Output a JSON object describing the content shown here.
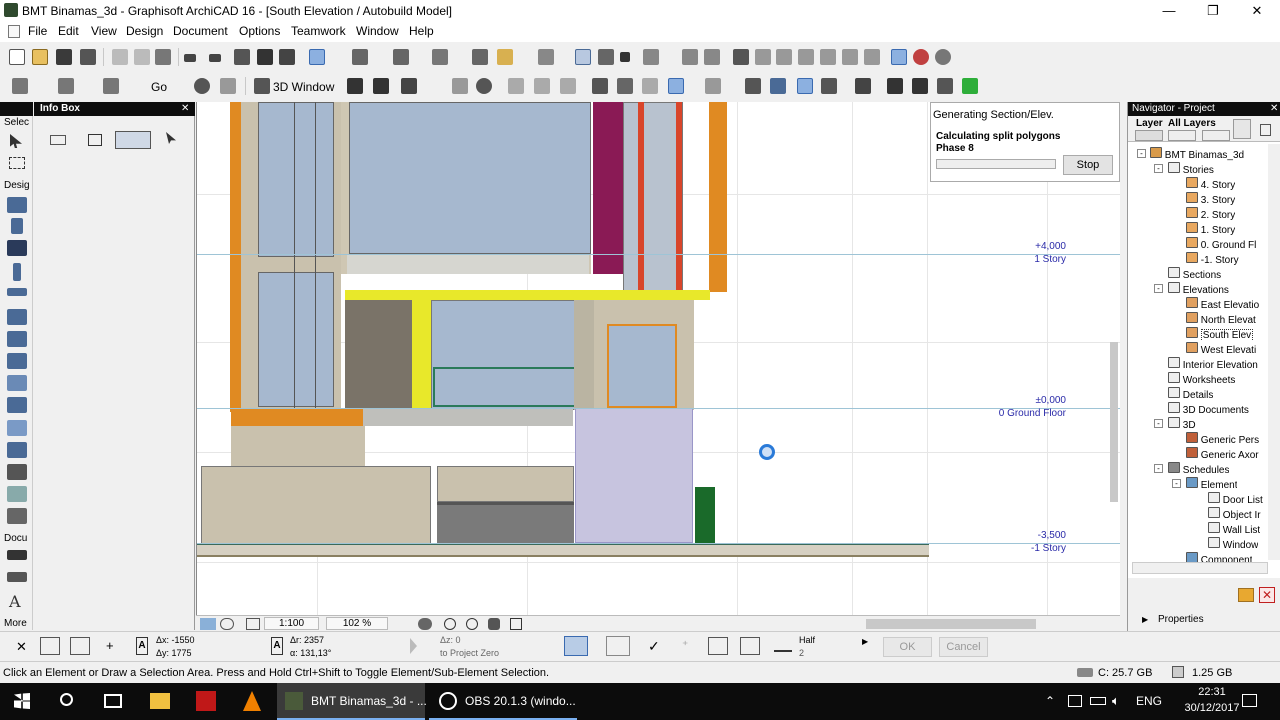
{
  "window": {
    "title": "BMT Binamas_3d - Graphisoft ArchiCAD 16 - [South Elevation / Autobuild Model]",
    "minimize": "—",
    "maximize": "❐",
    "close": "✕"
  },
  "menu": [
    "File",
    "Edit",
    "View",
    "Design",
    "Document",
    "Options",
    "Teamwork",
    "Window",
    "Help"
  ],
  "toolbar2": {
    "go_label": "Go",
    "window3d_label": "3D Window"
  },
  "toolbox": {
    "select_label": "Selec",
    "design_label": "Desig",
    "document_label": "Docu",
    "more_label": "More"
  },
  "infobox": {
    "title": "Info Box"
  },
  "progress": {
    "title": "Generating Section/Elev.",
    "line1": "Calculating split polygons",
    "line2": "Phase 8",
    "stop_label": "Stop"
  },
  "levels": [
    {
      "value": "+4,000",
      "name": "1 Story"
    },
    {
      "value": "±0,000",
      "name": "0 Ground Floor"
    },
    {
      "value": "-3,500",
      "name": "-1 Story"
    }
  ],
  "navigator": {
    "title": "Navigator - Project",
    "layer_label": "Layer",
    "all_layers_label": "All Layers",
    "project": "BMT Binamas_3d",
    "stories_label": "Stories",
    "stories": [
      "4. Story",
      "3. Story",
      "2. Story",
      "1. Story",
      "0. Ground Fl",
      "-1. Story"
    ],
    "sections_label": "Sections",
    "elevations_label": "Elevations",
    "elevations": [
      "East Elevatio",
      "North Elevat",
      "South Elev",
      "West Elevati"
    ],
    "other": [
      "Interior Elevation",
      "Worksheets",
      "Details",
      "3D Documents"
    ],
    "threed_label": "3D",
    "threed": [
      "Generic Pers",
      "Generic Axor"
    ],
    "schedules_label": "Schedules",
    "element_label": "Element",
    "element_items": [
      "Door List",
      "Object Ir",
      "Wall List",
      "Window"
    ],
    "component_label": "Component",
    "properties_label": "Properties"
  },
  "view_bar": {
    "scale": "1:100",
    "zoom": "102 %"
  },
  "coords": {
    "dx": "Δx: -1550",
    "dy": "Δy: 1775",
    "dr": "Δr: 2357",
    "da": "α: 131,13°",
    "dz": "Δz: 0",
    "ref": "to Project Zero",
    "half": "Half",
    "half_num": "2",
    "ok": "OK",
    "cancel": "Cancel"
  },
  "status": {
    "message": "Click an Element or Draw a Selection Area. Press and Hold Ctrl+Shift to Toggle Element/Sub-Element Selection.",
    "disk": "C: 25.7 GB",
    "mem": "1.25 GB"
  },
  "taskbar": {
    "app1": "BMT Binamas_3d - ...",
    "app2": "OBS 20.1.3 (windo...",
    "lang": "ENG",
    "time": "22:31",
    "date": "30/12/2017"
  }
}
